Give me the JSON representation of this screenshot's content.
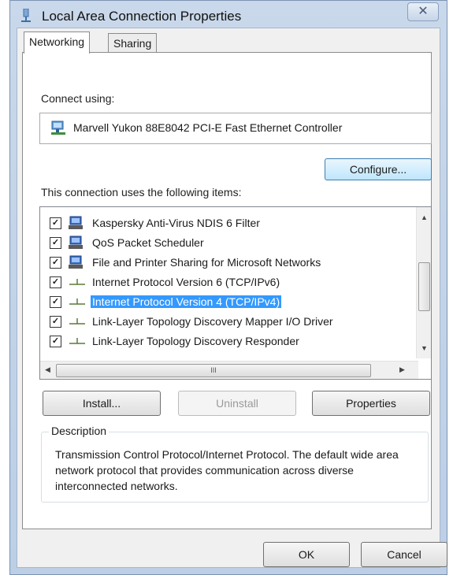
{
  "window": {
    "title": "Local Area Connection Properties",
    "close_glyph": "✕"
  },
  "tabs": [
    {
      "label": "Networking",
      "active": true
    },
    {
      "label": "Sharing",
      "active": false
    }
  ],
  "connect_using": {
    "label": "Connect using:",
    "adapter": "Marvell Yukon 88E8042 PCI-E Fast Ethernet Controller",
    "configure_label": "Configure..."
  },
  "items_section": {
    "label": "This connection uses the following items:",
    "items": [
      {
        "label": "Kaspersky Anti-Virus NDIS 6 Filter",
        "checked": true,
        "icon": "network-client-icon",
        "selected": false
      },
      {
        "label": "QoS Packet Scheduler",
        "checked": true,
        "icon": "network-client-icon",
        "selected": false
      },
      {
        "label": "File and Printer Sharing for Microsoft Networks",
        "checked": true,
        "icon": "network-client-icon",
        "selected": false
      },
      {
        "label": "Internet Protocol Version 6 (TCP/IPv6)",
        "checked": true,
        "icon": "protocol-icon",
        "selected": false
      },
      {
        "label": "Internet Protocol Version 4 (TCP/IPv4)",
        "checked": true,
        "icon": "protocol-icon",
        "selected": true
      },
      {
        "label": "Link-Layer Topology Discovery Mapper I/O Driver",
        "checked": true,
        "icon": "protocol-icon",
        "selected": false
      },
      {
        "label": "Link-Layer Topology Discovery Responder",
        "checked": true,
        "icon": "protocol-icon",
        "selected": false
      }
    ],
    "hscroll_grip": "III"
  },
  "buttons": {
    "install": "Install...",
    "uninstall": "Uninstall",
    "properties": "Properties"
  },
  "description": {
    "label": "Description",
    "text": "Transmission Control Protocol/Internet Protocol. The default wide area network protocol that provides communication across diverse interconnected networks."
  },
  "footer": {
    "ok": "OK",
    "cancel": "Cancel"
  },
  "colors": {
    "selection": "#3399ff",
    "titlebar": "#c9d8ea"
  }
}
